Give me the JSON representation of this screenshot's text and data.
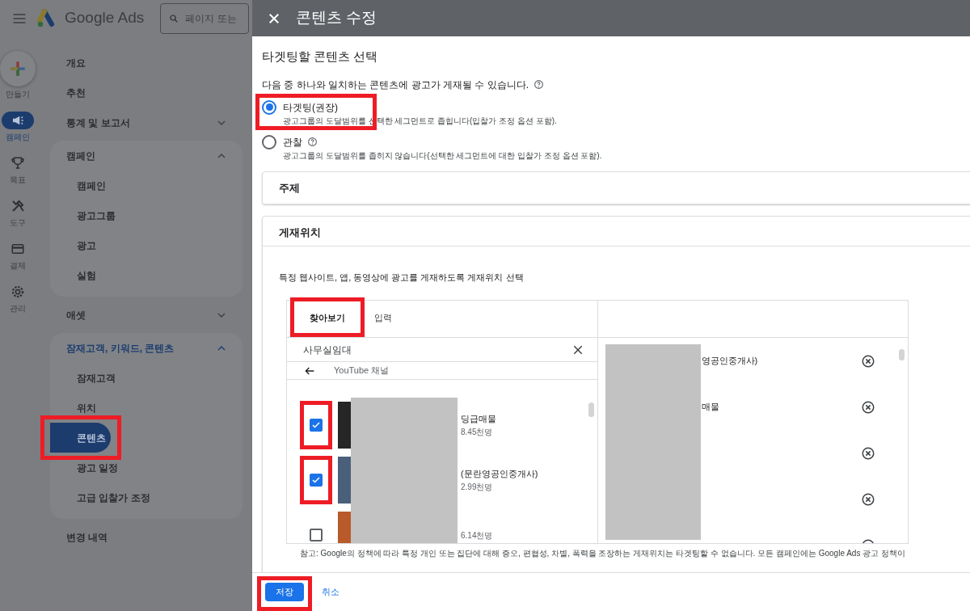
{
  "app_bar": {
    "logo_text": "Google Ads",
    "search": {
      "placeholder": "페이지 또는"
    }
  },
  "rail": [
    {
      "kind": "create",
      "label": "만들기",
      "selected": false
    },
    {
      "kind": "campaign",
      "label": "캠페인",
      "selected": true
    },
    {
      "kind": "goal",
      "label": "목표",
      "selected": false
    },
    {
      "kind": "tools",
      "label": "도구",
      "selected": false
    },
    {
      "kind": "billing",
      "label": "결제",
      "selected": false
    },
    {
      "kind": "admin",
      "label": "관리",
      "selected": false
    }
  ],
  "nav": [
    {
      "label": "개요"
    },
    {
      "label": "추천"
    },
    {
      "label": "통계 및 보고서",
      "expanded": false,
      "active": false
    },
    {
      "label": "캠페인",
      "expanded": true,
      "active": false,
      "children": [
        {
          "label": "캠페인",
          "selected": false,
          "highlighted": false
        },
        {
          "label": "광고그룹",
          "selected": false,
          "highlighted": false
        },
        {
          "label": "광고",
          "selected": false,
          "highlighted": false
        },
        {
          "label": "실험",
          "selected": false,
          "highlighted": false
        }
      ]
    },
    {
      "label": "애셋",
      "expanded": false,
      "active": false
    },
    {
      "label": "잠재고객, 키워드, 콘텐츠",
      "expanded": true,
      "active": true,
      "children": [
        {
          "label": "잠재고객",
          "selected": false,
          "highlighted": false
        },
        {
          "label": "위치",
          "selected": false,
          "highlighted": false
        },
        {
          "label": "콘텐츠",
          "selected": true,
          "highlighted": true
        },
        {
          "label": "광고 일정",
          "selected": false,
          "highlighted": false
        },
        {
          "label": "고급 입찰가 조정",
          "selected": false,
          "highlighted": false
        }
      ]
    },
    {
      "label": "변경 내역"
    }
  ],
  "dialog": {
    "title": "콘텐츠 수정",
    "heading": "타겟팅할 콘텐츠 선택",
    "description": "다음 중 하나와 일치하는 콘텐츠에 광고가 게재될 수 있습니다.",
    "options": [
      {
        "label": "타겟팅(권장)",
        "help": false,
        "detail": "광고그룹의 도달범위를 선택한 세그먼트로 좁힙니다(입찰가 조정 옵션 포함).",
        "selected": true,
        "highlighted": true
      },
      {
        "label": "관찰",
        "help": true,
        "detail": "광고그룹의 도달범위를 좁히지 않습니다(선택한 세그먼트에 대한 입찰가 조정 옵션 포함).",
        "selected": false,
        "highlighted": false
      }
    ],
    "topic_section": {
      "title": "주제"
    },
    "placement_section": {
      "title": "게재위치",
      "instruction": "특정 웹사이트, 앱, 동영상에 광고를 게재하도록 게재위치 선택",
      "tabs": [
        {
          "label": "찾아보기",
          "selected": true,
          "highlighted": true
        },
        {
          "label": "입력",
          "selected": false,
          "highlighted": false
        }
      ],
      "search_value": "사무실임대",
      "category": "YouTube 채널",
      "results": [
        {
          "name": "딩급매물",
          "subscribers": "8.45천명",
          "checked": true,
          "highlighted": true
        },
        {
          "name": "(문란영공인중개사)",
          "subscribers": "2.99천명",
          "checked": true,
          "highlighted": true
        },
        {
          "subscribers": "6.14천명",
          "checked": false,
          "highlighted": false
        }
      ],
      "selected_items": [
        {
          "kind": "named",
          "name": "영공인중개사)"
        },
        {
          "kind": "named",
          "name": "매물"
        },
        {
          "kind": "redacted"
        },
        {
          "kind": "redacted"
        },
        {
          "kind": "redacted"
        }
      ]
    },
    "note": "참고: Google의 정책에 따라 특정 개인 또는 집단에 대해 증오, 편협성, 차별, 폭력을 조장하는 게재위치는 타겟팅할 수 없습니다. 모든 캠페인에는 Google Ads 광고 정책이",
    "save": {
      "label": "저장",
      "highlighted": true
    },
    "cancel": "취소"
  }
}
